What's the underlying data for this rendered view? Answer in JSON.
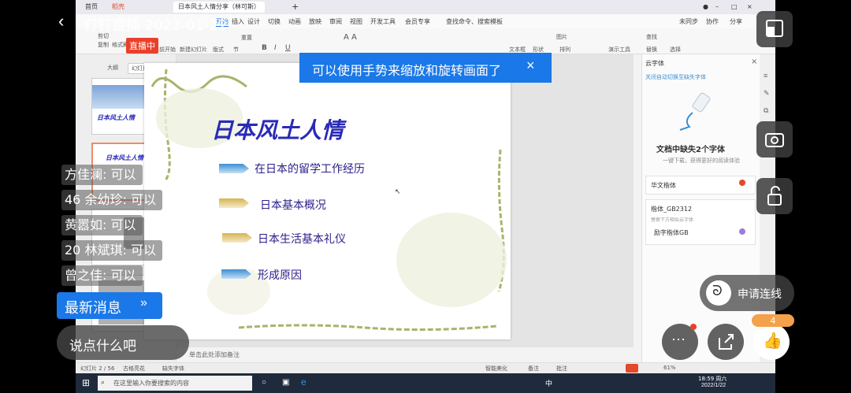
{
  "live": {
    "title": "钉钉直播 2022-01-22",
    "badge": "直播中",
    "toast": "可以使用手势来缩放和旋转画面了",
    "chat": [
      {
        "user": "方佳澜",
        "msg": "可以"
      },
      {
        "user": "46 余幼珍",
        "msg": "可以"
      },
      {
        "user": "黄嚣如",
        "msg": "可以"
      },
      {
        "user": "20 林斌琪",
        "msg": "可以"
      },
      {
        "user": "曾之佳",
        "msg": "可以"
      }
    ],
    "latest_button": "最新消息",
    "comment_placeholder": "说点什么吧",
    "connect_label": "申请连线",
    "like_count": "4"
  },
  "wps": {
    "tabs": [
      "首页",
      "稻壳",
      "日本风土人情分享（林可斯）"
    ],
    "menus": [
      "开始",
      "插入",
      "设计",
      "切换",
      "动画",
      "放映",
      "审阅",
      "视图",
      "开发工具",
      "会员专享",
      "查找命令、搜索模板"
    ],
    "ribbon": [
      "剪切",
      "复制",
      "格式刷",
      "从当前开始",
      "新建幻灯片",
      "版式",
      "节",
      "重置",
      "图片",
      "形状",
      "排列",
      "文本框",
      "演示工具",
      "查找",
      "替换",
      "选择"
    ],
    "panel_tabs": [
      "大纲",
      "幻灯片"
    ],
    "notes": "单击此处添加备注",
    "status": [
      "幻灯片 2 / 56",
      "古格亮花",
      "缺失字体",
      "智能美化",
      "备注",
      "批注"
    ],
    "zoom": "61%",
    "share": [
      "未同步",
      "协作",
      "分享"
    ],
    "right_panel": {
      "title": "云字体",
      "link": "关闭自动切换至缺失字体",
      "headline": "文档中缺失2个字体",
      "sub": "一键下载，获得更好的阅读体验",
      "fonts": [
        {
          "name": "华文楷体",
          "hint": ""
        },
        {
          "name": "楷体_GB2312",
          "hint": "替换下方相似云字体"
        },
        {
          "name": "励字楷体GB",
          "hint": ""
        }
      ]
    },
    "taskbar": {
      "search": "在这里输入你要搜索的内容",
      "time": "18:59 周六",
      "date": "2022/1/22",
      "ime": "中"
    }
  },
  "slide": {
    "title": "日本风土人情",
    "bullets": [
      {
        "text": "在日本的留学工作经历",
        "color": "#3a8fd6"
      },
      {
        "text": "日本基本概况",
        "color": "#d6b44e"
      },
      {
        "text": "日本生活基本礼仪",
        "color": "#d6b44e"
      },
      {
        "text": "形成原因",
        "color": "#3a8fd6"
      }
    ]
  },
  "colors": {
    "accent": "#1a78e8",
    "live_red": "#e9402b",
    "slide_title": "#2a2ab8"
  }
}
